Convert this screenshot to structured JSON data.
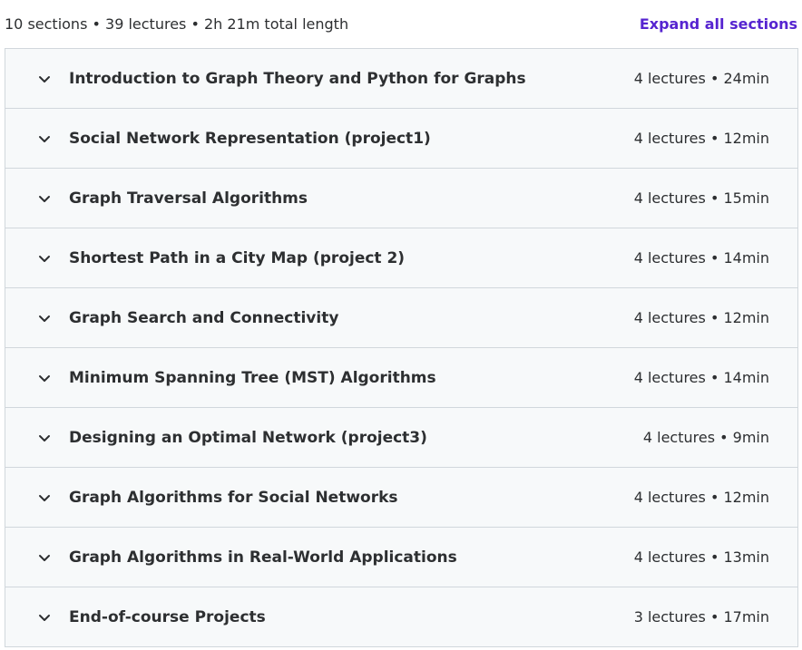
{
  "curriculum": {
    "summary": "10 sections • 39 lectures • 2h 21m total length",
    "expand_all_label": "Expand all sections",
    "sections": [
      {
        "title": "Introduction to Graph Theory and Python for Graphs",
        "meta": "4 lectures • 24min"
      },
      {
        "title": "Social Network Representation (project1)",
        "meta": "4 lectures • 12min"
      },
      {
        "title": "Graph Traversal Algorithms",
        "meta": "4 lectures • 15min"
      },
      {
        "title": "Shortest Path in a City Map (project 2)",
        "meta": "4 lectures • 14min"
      },
      {
        "title": "Graph Search and Connectivity",
        "meta": "4 lectures • 12min"
      },
      {
        "title": "Minimum Spanning Tree (MST) Algorithms",
        "meta": "4 lectures • 14min"
      },
      {
        "title": "Designing an Optimal Network (project3)",
        "meta": "4 lectures • 9min"
      },
      {
        "title": "Graph Algorithms for Social Networks",
        "meta": "4 lectures • 12min"
      },
      {
        "title": "Graph Algorithms in Real-World Applications",
        "meta": "4 lectures • 13min"
      },
      {
        "title": "End-of-course Projects",
        "meta": "3 lectures • 17min"
      }
    ],
    "section_icon": "chevron-down-icon"
  },
  "colors": {
    "accent": "#5624d0",
    "text": "#2d2f31",
    "row_background": "#f7f9fa",
    "border": "#d1d7dc"
  }
}
